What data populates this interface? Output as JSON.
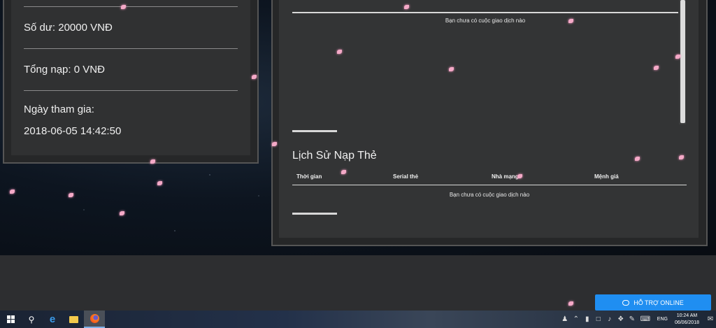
{
  "stats": {
    "balance_label": "Số dư: 20000 VNĐ",
    "total_topup_label": "Tổng nạp: 0 VNĐ",
    "join_date_label": "Ngày tham gia:",
    "join_date_value": "2018-06-05 14:42:50"
  },
  "transactions": {
    "empty_message": "Bạn chưa có cuộc giao dịch nào"
  },
  "card_history": {
    "title": "Lịch Sử Nạp Thẻ",
    "columns": [
      "Thời gian",
      "Serial thẻ",
      "Nhà mạng",
      "Mệnh giá"
    ],
    "empty_message": "Bạn chưa có cuộc giao dịch nào"
  },
  "support": {
    "label": "HỖ TRỢ ONLINE",
    "icon": "chat-icon"
  },
  "taskbar": {
    "language": "ENG",
    "time": "10:24 AM",
    "date": "06/06/2018"
  }
}
